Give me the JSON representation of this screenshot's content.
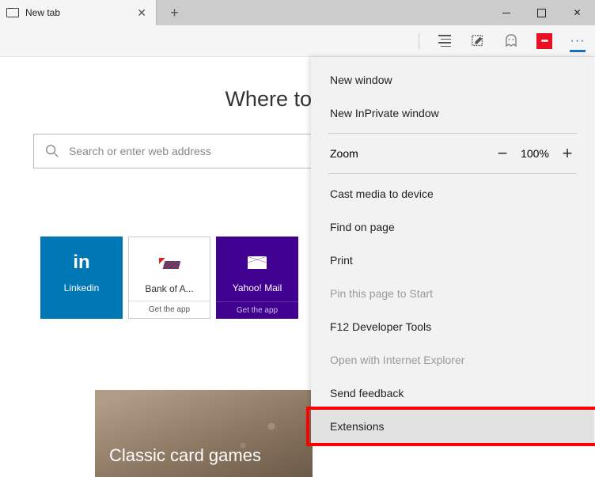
{
  "tab": {
    "title": "New tab"
  },
  "page": {
    "heading": "Where to next?",
    "search_placeholder": "Search or enter web address"
  },
  "tiles": [
    {
      "label": "Linkedin",
      "getapp": ""
    },
    {
      "label": "Bank of A...",
      "getapp": "Get the app"
    },
    {
      "label": "Yahoo! Mail",
      "getapp": "Get the app"
    }
  ],
  "card": {
    "title": "Classic card games"
  },
  "menu": {
    "new_window": "New window",
    "new_inprivate": "New InPrivate window",
    "zoom_label": "Zoom",
    "zoom_value": "100%",
    "cast": "Cast media to device",
    "find": "Find on page",
    "print": "Print",
    "pin": "Pin this page to Start",
    "devtools": "F12 Developer Tools",
    "open_ie": "Open with Internet Explorer",
    "feedback": "Send feedback",
    "extensions": "Extensions"
  }
}
